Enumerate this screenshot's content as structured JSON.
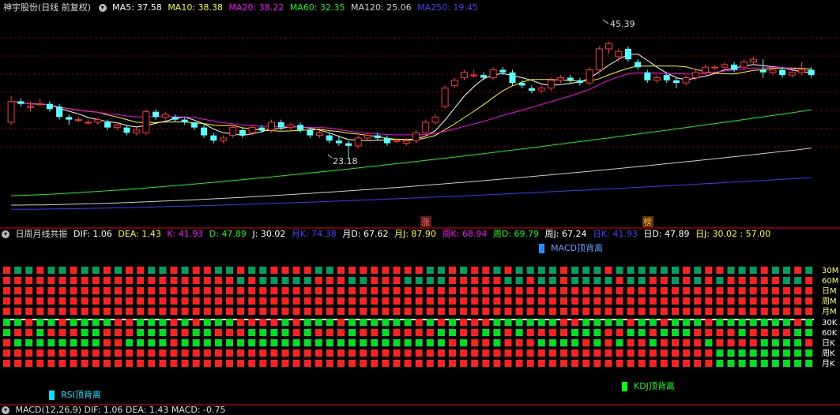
{
  "main_header": {
    "title": "神宇股份(日线 前复权)",
    "items": [
      {
        "label": "MA5: 37.58",
        "color": "#ffffff"
      },
      {
        "label": "MA10: 38.38",
        "color": "#ffff00"
      },
      {
        "label": "MA20: 38.22",
        "color": "#ff00ff"
      },
      {
        "label": "MA60: 32.35",
        "color": "#00ff00"
      },
      {
        "label": "MA120: 25.06",
        "color": "#d0d0d0"
      },
      {
        "label": "MA250: 19.45",
        "color": "#4040ff"
      }
    ]
  },
  "annotations": {
    "high": "45.39",
    "low": "23.18"
  },
  "markers": [
    {
      "text": "涨",
      "color": "#cc3333"
    },
    {
      "text": "榜",
      "color": "#cc8800"
    }
  ],
  "indicator_header": {
    "title": "日周月线共振",
    "items": [
      {
        "label": "DIF: 1.06",
        "color": "#ffffff"
      },
      {
        "label": "DEA: 1.43",
        "color": "#ffff00"
      },
      {
        "label": "K: 41.93",
        "color": "#ff00ff"
      },
      {
        "label": "D: 47.89",
        "color": "#00ff00"
      },
      {
        "label": "J: 30.02",
        "color": "#ffffff"
      },
      {
        "label": "月K: 74.38",
        "color": "#4040ff"
      },
      {
        "label": "月D: 67.62",
        "color": "#ffffff"
      },
      {
        "label": "月J: 87.90",
        "color": "#ffff00"
      },
      {
        "label": "周K: 68.94",
        "color": "#ff00ff"
      },
      {
        "label": "周D: 69.79",
        "color": "#00ff00"
      },
      {
        "label": "周J: 67.24",
        "color": "#ffffff"
      },
      {
        "label": "日K: 41.93",
        "color": "#4040ff"
      },
      {
        "label": "日D: 47.89",
        "color": "#ffffff"
      },
      {
        "label": "日J: 30.02 : 57.00",
        "color": "#ffff00"
      }
    ]
  },
  "legends": {
    "macd_div": "MACD顶背离",
    "rsi_div": "RSI顶背离",
    "kdj_div": "KDJ顶背离"
  },
  "grid_labels_top": [
    "30M",
    "60M",
    "日M",
    "周M",
    "月M"
  ],
  "grid_labels_bottom": [
    "30K",
    "60K",
    "日K",
    "周K",
    "月K"
  ],
  "bottom_header": {
    "text": "MACD(12,26,9) DIF: 1.06 DEA: 1.43 MACD: -0.75"
  },
  "chart_data": {
    "type": "candlestick",
    "series": [
      {
        "name": "MA5"
      },
      {
        "name": "MA10"
      },
      {
        "name": "MA20"
      },
      {
        "name": "MA60"
      },
      {
        "name": "MA120"
      },
      {
        "name": "MA250"
      }
    ],
    "ylim": [
      13,
      50
    ],
    "price_marks": {
      "high": 45.39,
      "low": 23.18
    },
    "candles": [
      [
        30.0,
        34.0,
        35.0,
        29.5
      ],
      [
        34.0,
        33.5,
        34.5,
        33.0
      ],
      [
        33.0,
        33.0,
        34.0,
        32.0
      ],
      [
        33.5,
        33.5,
        34.5,
        33.0
      ],
      [
        33.5,
        32.5,
        34.0,
        32.0
      ],
      [
        33.0,
        31.0,
        33.5,
        30.5
      ],
      [
        31.0,
        30.5,
        31.5,
        29.5
      ],
      [
        30.5,
        30.5,
        31.0,
        30.0
      ],
      [
        30.0,
        30.0,
        30.5,
        29.5
      ],
      [
        30.0,
        30.5,
        31.0,
        29.5
      ],
      [
        30.0,
        29.0,
        30.5,
        28.5
      ],
      [
        29.0,
        29.5,
        30.0,
        28.5
      ],
      [
        29.0,
        28.0,
        29.5,
        27.5
      ],
      [
        28.0,
        28.5,
        29.0,
        27.5
      ],
      [
        28.0,
        32.0,
        32.5,
        27.5
      ],
      [
        32.0,
        31.0,
        32.5,
        30.5
      ],
      [
        31.0,
        31.5,
        32.0,
        30.5
      ],
      [
        31.0,
        30.5,
        31.5,
        30.0
      ],
      [
        30.5,
        30.0,
        31.0,
        29.5
      ],
      [
        30.0,
        29.0,
        30.0,
        28.5
      ],
      [
        29.0,
        27.5,
        29.5,
        27.0
      ],
      [
        27.5,
        26.5,
        28.0,
        26.0
      ],
      [
        26.5,
        27.0,
        27.5,
        26.0
      ],
      [
        27.5,
        29.0,
        29.5,
        27.0
      ],
      [
        28.5,
        27.5,
        29.0,
        27.0
      ],
      [
        28.0,
        29.0,
        29.5,
        27.5
      ],
      [
        29.0,
        28.5,
        29.5,
        28.0
      ],
      [
        28.5,
        30.0,
        30.5,
        28.0
      ],
      [
        30.0,
        29.0,
        30.5,
        28.5
      ],
      [
        29.0,
        29.5,
        30.0,
        28.5
      ],
      [
        29.5,
        28.5,
        30.0,
        28.0
      ],
      [
        28.5,
        27.5,
        29.0,
        27.0
      ],
      [
        27.5,
        28.0,
        28.5,
        27.0
      ],
      [
        27.5,
        26.5,
        28.0,
        26.0
      ],
      [
        26.5,
        26.0,
        27.5,
        25.5
      ],
      [
        26.0,
        25.5,
        26.5,
        23.18
      ],
      [
        25.5,
        27.0,
        27.5,
        25.0
      ],
      [
        27.0,
        27.5,
        28.0,
        26.5
      ],
      [
        27.5,
        27.0,
        28.0,
        26.5
      ],
      [
        27.0,
        26.0,
        27.5,
        25.5
      ],
      [
        26.5,
        26.5,
        27.0,
        26.0
      ],
      [
        26.0,
        26.5,
        27.0,
        25.5
      ],
      [
        26.5,
        28.0,
        28.5,
        26.0
      ],
      [
        28.0,
        30.0,
        30.5,
        27.5
      ],
      [
        30.0,
        31.0,
        31.5,
        29.5
      ],
      [
        33.0,
        36.5,
        37.0,
        32.5
      ],
      [
        37.0,
        38.0,
        38.5,
        36.5
      ],
      [
        38.5,
        39.5,
        40.0,
        38.0
      ],
      [
        39.0,
        39.0,
        40.0,
        38.5
      ],
      [
        39.0,
        38.5,
        39.5,
        38.0
      ],
      [
        38.5,
        40.0,
        40.5,
        38.0
      ],
      [
        40.0,
        39.5,
        40.5,
        39.0
      ],
      [
        39.5,
        37.5,
        40.0,
        37.0
      ],
      [
        37.5,
        37.0,
        38.0,
        36.5
      ],
      [
        36.5,
        36.0,
        37.0,
        35.5
      ],
      [
        36.0,
        36.5,
        37.0,
        35.5
      ],
      [
        36.5,
        38.0,
        38.5,
        36.0
      ],
      [
        38.0,
        38.5,
        39.0,
        37.5
      ],
      [
        38.5,
        38.0,
        39.0,
        37.5
      ],
      [
        38.0,
        37.5,
        38.5,
        37.0
      ],
      [
        37.5,
        40.0,
        40.5,
        37.0
      ],
      [
        40.0,
        44.0,
        44.5,
        39.5
      ],
      [
        44.0,
        45.0,
        45.39,
        43.0
      ],
      [
        42.5,
        43.5,
        44.0,
        41.5
      ],
      [
        44.0,
        42.0,
        44.5,
        41.5
      ],
      [
        41.5,
        40.5,
        42.0,
        40.0
      ],
      [
        39.5,
        38.0,
        40.0,
        37.5
      ],
      [
        38.0,
        38.5,
        39.0,
        37.5
      ],
      [
        39.0,
        38.0,
        39.5,
        37.5
      ],
      [
        38.0,
        37.5,
        38.5,
        36.5
      ],
      [
        37.5,
        38.5,
        39.0,
        37.0
      ],
      [
        38.5,
        39.5,
        40.0,
        38.0
      ],
      [
        39.5,
        40.5,
        41.0,
        39.0
      ],
      [
        40.5,
        40.5,
        41.0,
        40.0
      ],
      [
        40.5,
        41.0,
        41.5,
        40.0
      ],
      [
        41.0,
        40.0,
        41.5,
        39.5
      ],
      [
        40.5,
        41.5,
        42.0,
        40.0
      ],
      [
        41.5,
        42.0,
        42.5,
        41.0
      ],
      [
        40.0,
        39.5,
        42.0,
        38.5
      ],
      [
        39.5,
        40.0,
        40.5,
        39.0
      ],
      [
        40.0,
        39.0,
        40.5,
        38.5
      ],
      [
        39.0,
        39.5,
        40.0,
        38.5
      ],
      [
        39.5,
        40.0,
        41.5,
        39.0
      ],
      [
        40.0,
        39.0,
        40.5,
        38.5
      ]
    ]
  }
}
